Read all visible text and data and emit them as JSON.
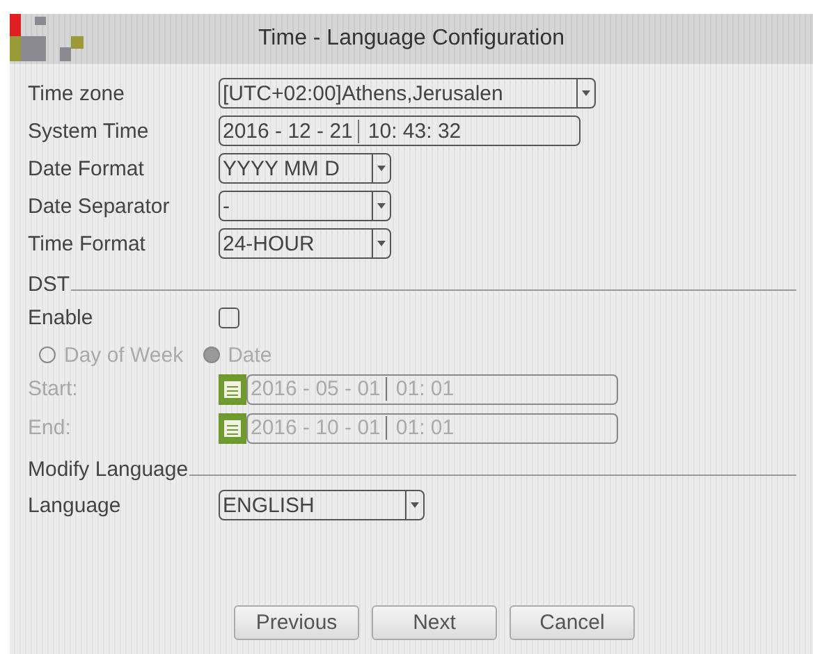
{
  "window": {
    "title": "Time - Language Configuration"
  },
  "fields": [
    {
      "label": "Time zone",
      "kind": "select",
      "value": "[UTC+02:00]Athens,Jerusalen"
    },
    {
      "label": "System Time",
      "kind": "datetime",
      "date": "2016 - 12 - 21",
      "time": "10: 43: 32"
    },
    {
      "label": "Date Format",
      "kind": "select",
      "value": "YYYY MM D"
    },
    {
      "label": "Date Separator",
      "kind": "select",
      "value": "-"
    },
    {
      "label": "Time Format",
      "kind": "select",
      "value": "24-HOUR"
    }
  ],
  "dst": {
    "heading": "DST",
    "enable": {
      "label": "Enable",
      "checked": false
    },
    "disabled": true,
    "modes": [
      {
        "label": "Day of Week",
        "selected": false
      },
      {
        "label": "Date",
        "selected": true
      }
    ],
    "ranges": [
      {
        "label": "Start:",
        "date": "2016 - 05 - 01",
        "time": "01: 01"
      },
      {
        "label": "End:",
        "date": "2016 - 10 - 01",
        "time": "01: 01"
      }
    ]
  },
  "language": {
    "heading": "Modify Language",
    "label": "Language",
    "value": "ENGLISH"
  },
  "buttons": [
    "Previous",
    "Next",
    "Cancel"
  ]
}
